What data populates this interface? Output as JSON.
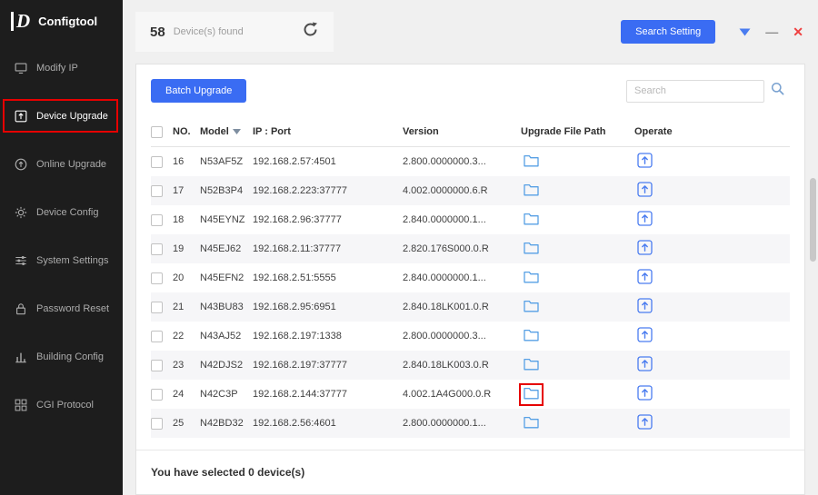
{
  "app": {
    "title": "Configtool",
    "window_controls": {
      "minimize": "—",
      "close": "✕"
    }
  },
  "header": {
    "device_count": "58",
    "device_found_label": "Device(s) found",
    "search_setting_label": "Search Setting"
  },
  "sidebar": {
    "items": [
      {
        "label": "Modify IP",
        "icon": "modify-ip-icon",
        "active": false
      },
      {
        "label": "Device Upgrade",
        "icon": "device-upgrade-icon",
        "active": true,
        "annotated": true
      },
      {
        "label": "Online Upgrade",
        "icon": "online-upgrade-icon",
        "active": false
      },
      {
        "label": "Device Config",
        "icon": "device-config-icon",
        "active": false
      },
      {
        "label": "System Settings",
        "icon": "system-settings-icon",
        "active": false
      },
      {
        "label": "Password Reset",
        "icon": "password-reset-icon",
        "active": false
      },
      {
        "label": "Building Config",
        "icon": "building-config-icon",
        "active": false
      },
      {
        "label": "CGI Protocol",
        "icon": "cgi-protocol-icon",
        "active": false
      }
    ]
  },
  "toolbar": {
    "batch_upgrade_label": "Batch Upgrade",
    "search_placeholder": "Search"
  },
  "table": {
    "headers": {
      "no": "NO.",
      "model": "Model",
      "ip_port": "IP : Port",
      "version": "Version",
      "upgrade_file_path": "Upgrade File Path",
      "operate": "Operate"
    },
    "rows": [
      {
        "no": "16",
        "model": "N53AF5Z",
        "ip_port": "192.168.2.57:4501",
        "version": "2.800.0000000.3..."
      },
      {
        "no": "17",
        "model": "N52B3P4",
        "ip_port": "192.168.2.223:37777",
        "version": "4.002.0000000.6.R"
      },
      {
        "no": "18",
        "model": "N45EYNZ",
        "ip_port": "192.168.2.96:37777",
        "version": "2.840.0000000.1..."
      },
      {
        "no": "19",
        "model": "N45EJ62",
        "ip_port": "192.168.2.11:37777",
        "version": "2.820.176S000.0.R"
      },
      {
        "no": "20",
        "model": "N45EFN2",
        "ip_port": "192.168.2.51:5555",
        "version": "2.840.0000000.1..."
      },
      {
        "no": "21",
        "model": "N43BU83",
        "ip_port": "192.168.2.95:6951",
        "version": "2.840.18LK001.0.R"
      },
      {
        "no": "22",
        "model": "N43AJ52",
        "ip_port": "192.168.2.197:1338",
        "version": "2.800.0000000.3..."
      },
      {
        "no": "23",
        "model": "N42DJS2",
        "ip_port": "192.168.2.197:37777",
        "version": "2.840.18LK003.0.R"
      },
      {
        "no": "24",
        "model": "N42C3P",
        "ip_port": "192.168.2.144:37777",
        "version": "4.002.1A4G000.0.R"
      },
      {
        "no": "25",
        "model": "N42BD32",
        "ip_port": "192.168.2.56:4601",
        "version": "2.800.0000000.1..."
      }
    ]
  },
  "footer": {
    "selected_summary": "You have selected 0  device(s)"
  },
  "icons": {
    "refresh": "circular-arrow",
    "search": "magnifier",
    "folder": "blue-folder-outline",
    "upload": "square-with-up-arrow",
    "sort": "down-triangle",
    "dropdown": "blue-down-triangle"
  },
  "colors": {
    "accent_blue": "#3a6cf3",
    "folder_icon_blue": "#57a0e5",
    "upload_icon_blue": "#4a7cf0",
    "annotation_red": "#e60000",
    "close_red": "#ef4040",
    "sidebar_bg": "#1d1d1d"
  }
}
